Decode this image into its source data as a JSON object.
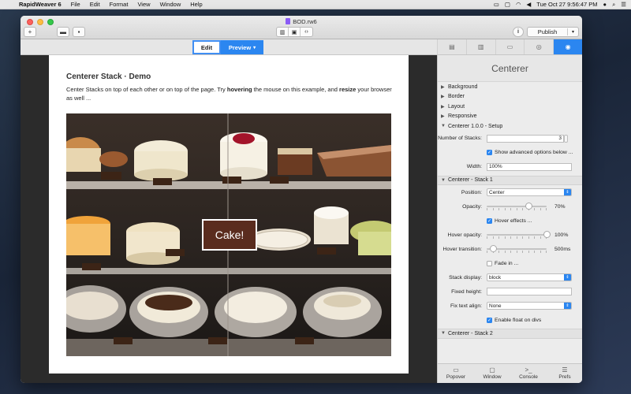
{
  "menubar": {
    "app_name": "RapidWeaver 6",
    "items": [
      "File",
      "Edit",
      "Format",
      "View",
      "Window",
      "Help"
    ],
    "clock": "Tue Oct 27   9:56:47 PM"
  },
  "window": {
    "doc_title": "BOD.rw6",
    "add_label": "+",
    "publish_label": "Publish",
    "mode_edit": "Edit",
    "mode_preview": "Preview"
  },
  "page": {
    "heading": "Centerer Stack · Demo",
    "para_1": "Center Stacks on top of each other or on top of the page. Try ",
    "para_bold_1": "hovering",
    "para_2": " the mouse on this example, and ",
    "para_bold_2": "resize",
    "para_3": " your browser as well ...",
    "hero_button": "Cake!"
  },
  "inspector": {
    "title": "Centerer",
    "sections": {
      "background": "Background",
      "border": "Border",
      "layout": "Layout",
      "responsive": "Responsive",
      "setup": "Centerer 1.0.0 - Setup",
      "stack1": "Centerer - Stack 1",
      "stack2": "Centerer - Stack 2"
    },
    "setup": {
      "num_stacks_label": "Number of Stacks:",
      "num_stacks_value": "3",
      "show_advanced_label": "Show advanced options below ...",
      "width_label": "Width:",
      "width_value": "100%"
    },
    "stack1": {
      "position_label": "Position:",
      "position_value": "Center",
      "opacity_label": "Opacity:",
      "opacity_value": "70%",
      "opacity_level": 0.7,
      "hover_effects_label": "Hover effects ...",
      "hover_opacity_label": "Hover opacity:",
      "hover_opacity_value": "100%",
      "hover_opacity_level": 1.0,
      "hover_transition_label": "Hover transition:",
      "hover_transition_value": "500ms",
      "hover_transition_level": 0.1,
      "fade_in_label": "Fade in ...",
      "stack_display_label": "Stack display:",
      "stack_display_value": "block",
      "fixed_height_label": "Fixed height:",
      "fixed_height_value": "",
      "fix_text_align_label": "Fix text align:",
      "fix_text_align_value": "None",
      "enable_float_label": "Enable float on divs"
    },
    "footer": {
      "popover": "Popover",
      "window": "Window",
      "console": "Console",
      "prefs": "Prefs"
    }
  },
  "colors": {
    "accent": "#2b86f0",
    "cake_button_bg": "#5a2c1e"
  }
}
